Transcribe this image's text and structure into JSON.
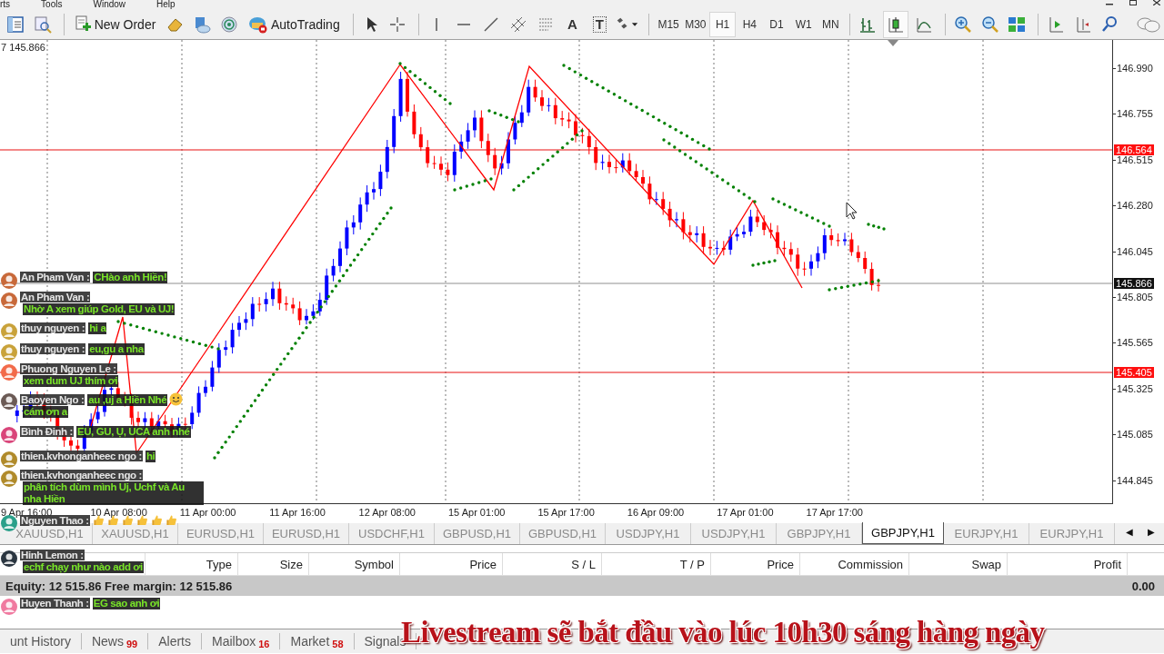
{
  "menu": [
    "rts",
    "Tools",
    "Window",
    "Help"
  ],
  "toolbar": {
    "new_order_label": "New Order",
    "autotrading_label": "AutoTrading",
    "text_tool_glyph": "A",
    "label_tool_glyph": "T",
    "timeframes": [
      {
        "label": "M15",
        "selected": false
      },
      {
        "label": "M30",
        "selected": false
      },
      {
        "label": "H1",
        "selected": true
      },
      {
        "label": "H4",
        "selected": false
      },
      {
        "label": "D1",
        "selected": false
      },
      {
        "label": "W1",
        "selected": false
      },
      {
        "label": "MN",
        "selected": false
      }
    ],
    "chart_types": [
      {
        "selected": false
      },
      {
        "selected": true
      },
      {
        "selected": false
      }
    ]
  },
  "chart": {
    "corner_label": "7 145.866",
    "price_ticks": [
      "146.990",
      "146.755",
      "146.515",
      "146.280",
      "146.045",
      "145.805",
      "145.565",
      "145.325",
      "145.085",
      "144.845"
    ],
    "price_markers": [
      {
        "text": "146.564",
        "kind": "alert"
      },
      {
        "text": "145.866",
        "kind": "bid"
      },
      {
        "text": "145.405",
        "kind": "alert"
      }
    ],
    "time_labels": [
      "9 Apr 16:00",
      "10 Apr 08:00",
      "11 Apr 00:00",
      "11 Apr 16:00",
      "12 Apr 08:00",
      "15 Apr 01:00",
      "15 Apr 17:00",
      "16 Apr 09:00",
      "17 Apr 01:00",
      "17 Apr 17:00"
    ]
  },
  "chart_tabs": [
    {
      "label": "XAUUSD,H1",
      "selected": false
    },
    {
      "label": "XAUUSD,H1",
      "selected": false
    },
    {
      "label": "EURUSD,H1",
      "selected": false
    },
    {
      "label": "EURUSD,H1",
      "selected": false
    },
    {
      "label": "USDCHF,H1",
      "selected": false
    },
    {
      "label": "GBPUSD,H1",
      "selected": false
    },
    {
      "label": "GBPUSD,H1",
      "selected": false
    },
    {
      "label": "USDJPY,H1",
      "selected": false
    },
    {
      "label": "USDJPY,H1",
      "selected": false
    },
    {
      "label": "GBPJPY,H1",
      "selected": false
    },
    {
      "label": "GBPJPY,H1",
      "selected": true
    },
    {
      "label": "EURJPY,H1",
      "selected": false
    },
    {
      "label": "EURJPY,H1",
      "selected": false
    }
  ],
  "tab_scroll": [
    "◀",
    "▶"
  ],
  "terminal": {
    "columns": [
      "Type",
      "Size",
      "Symbol",
      "Price",
      "S / L",
      "T / P",
      "Price",
      "Commission",
      "Swap",
      "Profit"
    ],
    "summary": "Equity: 12 515.86  Free margin: 12 515.86",
    "profit": "0.00"
  },
  "bottom_tabs": [
    {
      "label": "unt History"
    },
    {
      "label": "News",
      "count": "99"
    },
    {
      "label": "Alerts"
    },
    {
      "label": "Mailbox",
      "count": "16"
    },
    {
      "label": "Market",
      "count": "58"
    },
    {
      "label": "Signals"
    }
  ],
  "chat": [
    {
      "name": "An Pham Van :",
      "color": "#c8693a",
      "parts": [
        {
          "kind": "text",
          "text": "CHào anh Hiền!"
        }
      ]
    },
    {
      "name": "An Pham Van :",
      "color": "#c8693a",
      "parts": [
        {
          "kind": "text",
          "text": "Nhờ A xem giúp Gold, EU và UJ!"
        }
      ]
    },
    {
      "name": "thuy nguyen :",
      "color": "#c9a23a",
      "parts": [
        {
          "kind": "text",
          "text": "hi a"
        }
      ]
    },
    {
      "name": "thuy nguyen :",
      "color": "#c9a23a",
      "parts": [
        {
          "kind": "text",
          "text": "eu,gu a nha"
        }
      ]
    },
    {
      "name": "Phuong Nguyen Le :",
      "color": "#f26b4a",
      "parts": [
        {
          "kind": "text",
          "text": "xem dum UJ thím ơi"
        }
      ]
    },
    {
      "name": "Baoyen Ngo :",
      "color": "#6b5a55",
      "parts": [
        {
          "kind": "text",
          "text": "au ,uj a Hiền Nhé"
        },
        {
          "kind": "smile"
        },
        {
          "kind": "text",
          "text": "cám ơn a"
        }
      ]
    },
    {
      "name": "Bình Đinh :",
      "color": "#d9457a",
      "parts": [
        {
          "kind": "text",
          "text": "EU, GU, Ụ, UCA anh nhé"
        }
      ]
    },
    {
      "name": "thien.kvhonganheec ngo :",
      "color": "#b08a2a",
      "parts": [
        {
          "kind": "text",
          "text": "hi"
        }
      ]
    },
    {
      "name": "thien.kvhonganheec ngo :",
      "color": "#b08a2a",
      "parts": [
        {
          "kind": "text",
          "text": "phân tích dùm mình Uj, Uchf và Au nha Hiền"
        }
      ]
    },
    {
      "name": "Nguyen Thao :",
      "color": "#2aa08a",
      "parts": [
        {
          "kind": "thumb"
        },
        {
          "kind": "thumb"
        },
        {
          "kind": "thumb"
        },
        {
          "kind": "thumb"
        },
        {
          "kind": "thumb"
        },
        {
          "kind": "thumb"
        }
      ]
    },
    {
      "name": "Hinh Lemon :",
      "color": "#2a3540",
      "parts": [
        {
          "kind": "text",
          "text": "echf chạy như nào add ơi"
        }
      ]
    },
    {
      "name": "Huyen Thanh :",
      "color": "#f07aa0",
      "parts": [
        {
          "kind": "text",
          "text": "EG sao anh ơi"
        }
      ]
    }
  ],
  "banner": "Livestream sẽ bắt đầu vào lúc 10h30 sáng hàng ngày"
}
